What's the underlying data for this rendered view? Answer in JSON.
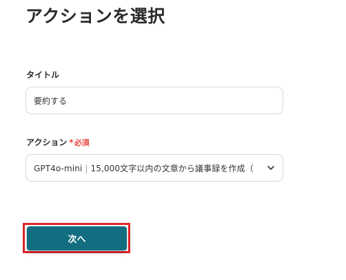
{
  "page": {
    "title": "アクションを選択"
  },
  "form": {
    "title_field": {
      "label": "タイトル",
      "value": "要約する"
    },
    "action_field": {
      "label": "アクション",
      "required_mark": "*",
      "required_text": "必須",
      "model": "GPT4o-mini",
      "separator": "|",
      "description": "15,000文字以内の文章から議事録を作成（",
      "icon": "chevron-down-icon"
    }
  },
  "buttons": {
    "next_label": "次へ"
  },
  "colors": {
    "primary": "#116d7f",
    "required": "#e8483d",
    "highlight_outline": "#e2242b"
  }
}
